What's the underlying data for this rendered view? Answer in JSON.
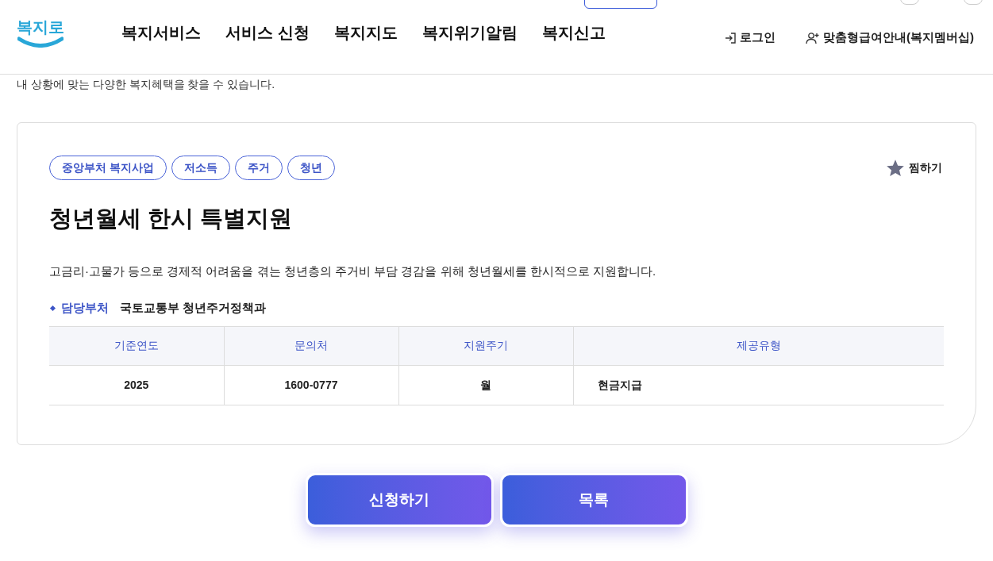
{
  "header": {
    "logo": "복지로",
    "nav": [
      {
        "label": "복지서비스"
      },
      {
        "label": "서비스 신청"
      },
      {
        "label": "복지지도"
      },
      {
        "label": "복지위기알림"
      },
      {
        "label": "복지신고"
      }
    ],
    "login": "로그인",
    "membership": "맞춤형급여안내(복지멤버십)"
  },
  "intro": "내 상황에 맞는 다양한 복지혜택을 찾을 수 있습니다.",
  "card": {
    "tags": [
      "중앙부처 복지사업",
      "저소득",
      "주거",
      "청년"
    ],
    "favorite": {
      "label": "찜하기",
      "selected": false
    },
    "title": "청년월세 한시 특별지원",
    "description": "고금리·고물가 등으로 경제적 어려움을 겪는 청년층의 주거비 부담 경감을 위해 청년월세를 한시적으로 지원합니다.",
    "department": {
      "label": "담당부처",
      "value": "국토교통부 청년주거정책과"
    },
    "table": {
      "columns": [
        "기준연도",
        "문의처",
        "지원주기",
        "제공유형"
      ],
      "rows": [
        [
          "2025",
          "1600-0777",
          "월",
          "현금지급"
        ]
      ]
    }
  },
  "buttons": [
    "신청하기",
    "목록"
  ]
}
